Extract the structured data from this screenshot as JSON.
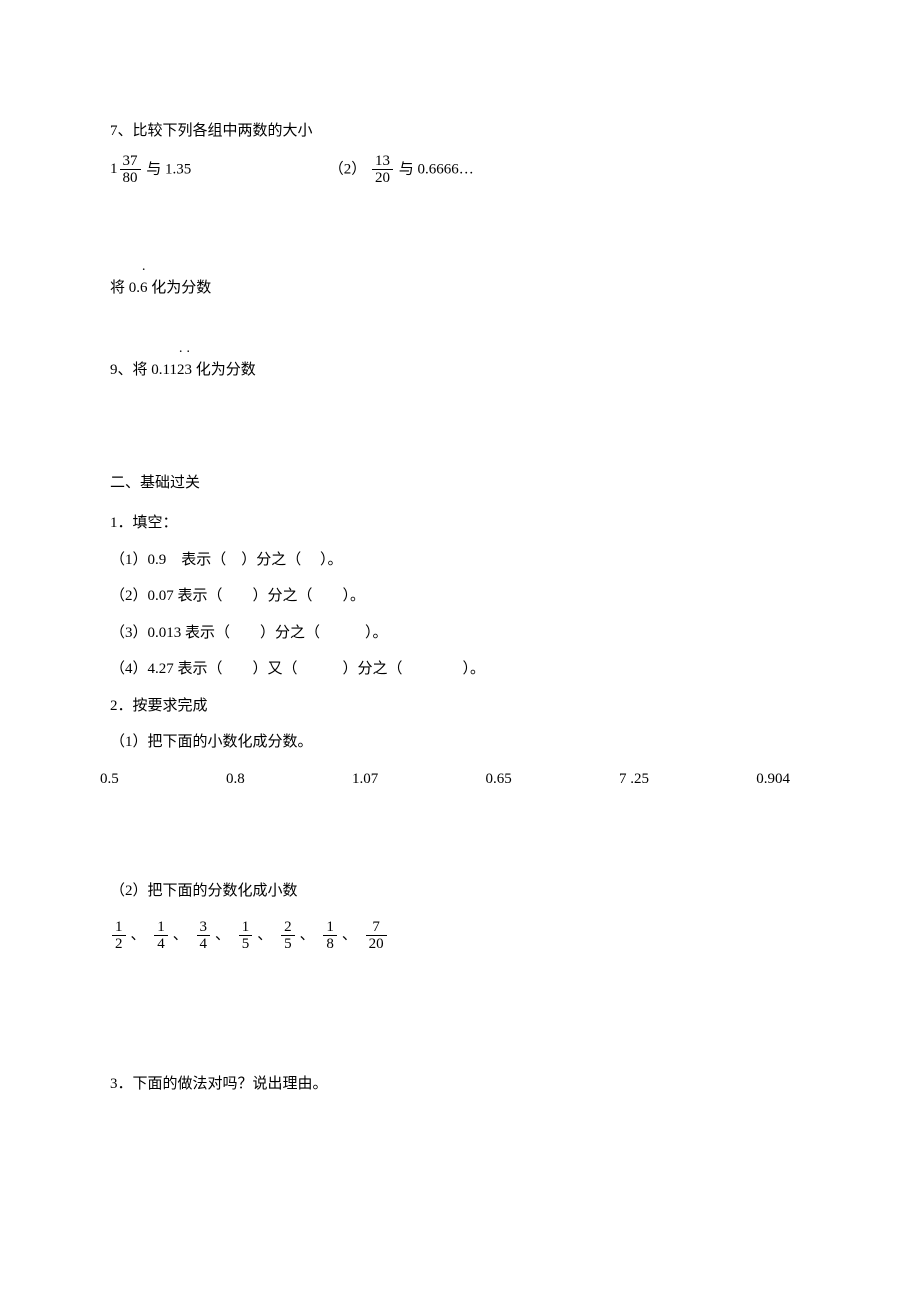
{
  "q7": {
    "title": "7、比较下列各组中两数的大小",
    "part1_whole": "1",
    "part1_num": "37",
    "part1_den": "80",
    "part1_with": "与 1.35",
    "part2_label": "（2）",
    "part2_num": "13",
    "part2_den": "20",
    "part2_with": "与 0.6666…"
  },
  "q8": {
    "prefix": "将 0.",
    "repeat_digit": "6",
    "suffix": " 化为分数"
  },
  "q9": {
    "prefix": "9、将 0.11",
    "repeat_d1": "2",
    "repeat_d2": "3",
    "suffix": " 化为分数"
  },
  "section2": {
    "heading": "二、基础过关",
    "q1_heading": "1．填空：",
    "fill": [
      "（1）0.9　表示（　）分之（　 ）。",
      "（2）0.07 表示（　　）分之（　　）。",
      "（3）0.013 表示（　　）分之（　　　）。",
      "（4）4.27 表示（　　）又（　　　）分之（　　　　）。"
    ],
    "q2_heading": "2．按要求完成",
    "q2_sub1": "（1）把下面的小数化成分数。",
    "decimals": [
      "0.5",
      "0.8",
      "1.07",
      "0.65",
      "7 .25",
      "0.904"
    ],
    "q2_sub2": "（2）把下面的分数化成小数",
    "fractions": [
      {
        "num": "1",
        "den": "2"
      },
      {
        "num": "1",
        "den": "4"
      },
      {
        "num": "3",
        "den": "4"
      },
      {
        "num": "1",
        "den": "5"
      },
      {
        "num": "2",
        "den": "5"
      },
      {
        "num": "1",
        "den": "8"
      },
      {
        "num": "7",
        "den": "20"
      }
    ],
    "frac_sep": "、",
    "q3_heading": "3．下面的做法对吗？说出理由。"
  }
}
